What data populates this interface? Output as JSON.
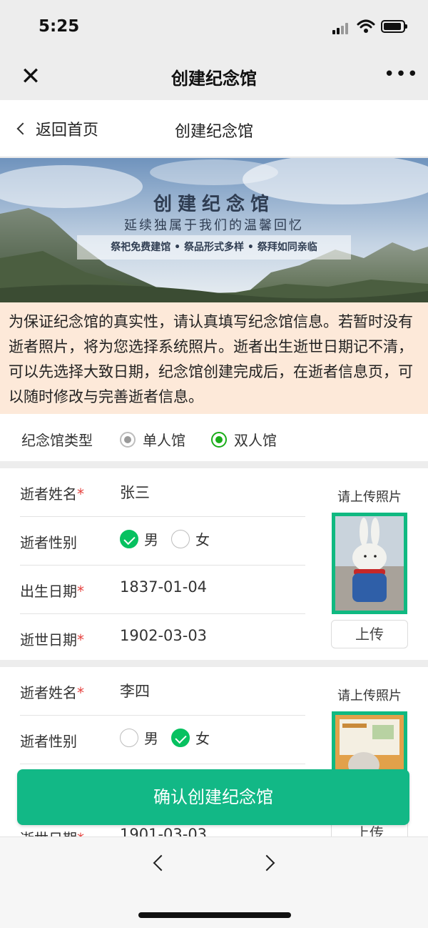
{
  "status": {
    "time": "5:25"
  },
  "wx": {
    "title": "创建纪念馆",
    "close_icon": "close-icon",
    "more_icon": "more-icon"
  },
  "header": {
    "back_label": "返回首页",
    "title": "创建纪念馆"
  },
  "banner": {
    "title": "创建纪念馆",
    "subtitle": "延续独属于我们的温馨回忆",
    "tagline": "祭祀免费建馆 • 祭品形式多样 • 祭拜如同亲临"
  },
  "notice": "为保证纪念馆的真实性，请认真填写纪念馆信息。若暂时没有逝者照片，将为您选择系统照片。逝者出生逝世日期记不清，可以先选择大致日期，纪念馆创建完成后，在逝者信息页，可以随时修改与完善逝者信息。",
  "memorial_type": {
    "label": "纪念馆类型",
    "options": [
      "单人馆",
      "双人馆"
    ],
    "selected": "双人馆"
  },
  "labels": {
    "name": "逝者姓名",
    "gender": "逝者性别",
    "birth": "出生日期",
    "death": "逝世日期",
    "required": "*",
    "male": "男",
    "female": "女",
    "upload_hint": "请上传照片",
    "upload_button": "上传"
  },
  "persons": [
    {
      "name": "张三",
      "gender": "男",
      "birth": "1837-01-04",
      "death": "1902-03-03"
    },
    {
      "name": "李四",
      "gender": "女",
      "death": "1901-03-03"
    }
  ],
  "confirm_label": "确认创建纪念馆",
  "colors": {
    "accent": "#12b886",
    "notice_bg": "#fde9d9",
    "required": "#e64340"
  }
}
